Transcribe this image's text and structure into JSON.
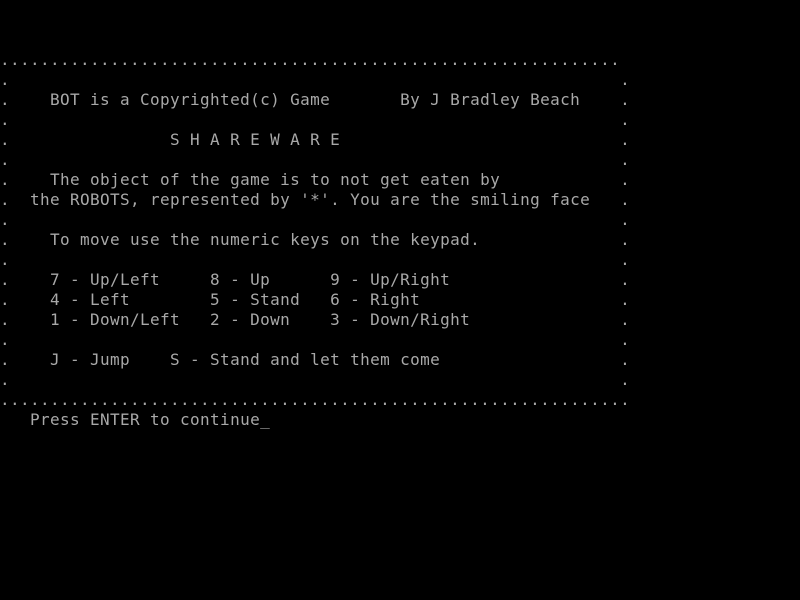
{
  "screen": {
    "border_top": ".............................................................. ",
    "border_bottom": "...............................................................",
    "lines": [
      ".                                                             .",
      ".    BOT is a Copyrighted(c) Game       By J Bradley Beach    .",
      ".                                                             .",
      ".                S H A R E W A R E                            .",
      ".                                                             .",
      ".    The object of the game is to not get eaten by            .",
      ".  the ROBOTS, represented by '*'. You are the smiling face   .",
      ".                                                             .",
      ".    To move use the numeric keys on the keypad.              .",
      ".                                                             .",
      ".    7 - Up/Left     8 - Up      9 - Up/Right                 .",
      ".    4 - Left        5 - Stand   6 - Right                    .",
      ".    1 - Down/Left   2 - Down    3 - Down/Right               .",
      ".                                                             .",
      ".    J - Jump    S - Stand and let them come                  .",
      ".                                                             ."
    ],
    "prompt": "   Press ENTER to continue",
    "cursor": "_"
  },
  "colors": {
    "background": "#000000",
    "text": "#a8a8a8"
  }
}
